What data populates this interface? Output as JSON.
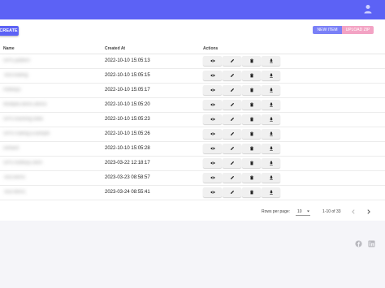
{
  "header": {
    "account_icon": "account-download-icon"
  },
  "toolbar": {
    "create_label": "CREATE",
    "new_item_label": "NEW ITEM",
    "upload_zip_label": "UPLOAD ZIP"
  },
  "table": {
    "columns": [
      "Name",
      "Created At",
      "Actions"
    ],
    "rows": [
      {
        "name": "GPS.pattern",
        "created_at": "2022-10-10 15:05:13"
      },
      {
        "name": "Test.trailing",
        "created_at": "2022-10-10 15:05:15"
      },
      {
        "name": "Hotkeys",
        "created_at": "2022-10-10 15:05:17"
      },
      {
        "name": "Multiple.items.demo",
        "created_at": "2022-10-10 15:05:20"
      },
      {
        "name": "GPS.tracking.data",
        "created_at": "2022-10-10 15:05:23"
      },
      {
        "name": "GPSTrailing.Example",
        "created_at": "2022-10-10 15:05:26"
      },
      {
        "name": "Default",
        "created_at": "2022-10-10 15:05:28"
      },
      {
        "name": "GPS.hotkeys.item",
        "created_at": "2023-03-22 12:18:17"
      },
      {
        "name": "Test.items",
        "created_at": "2023-03-23 08:58:57"
      },
      {
        "name": "Test.Item1",
        "created_at": "2023-03-24 08:55:41"
      }
    ],
    "action_icons": [
      "eye-icon",
      "pencil-icon",
      "trash-icon",
      "download-icon"
    ]
  },
  "pagination": {
    "rows_per_page_label": "Rows per page:",
    "rows_per_page_value": "10",
    "range_text": "1-10 of 33"
  },
  "footer": {
    "icons": [
      "facebook-icon",
      "linkedin-icon"
    ]
  },
  "colors": {
    "primary": "#5c62f5",
    "secondary": "#f3a3c4"
  }
}
